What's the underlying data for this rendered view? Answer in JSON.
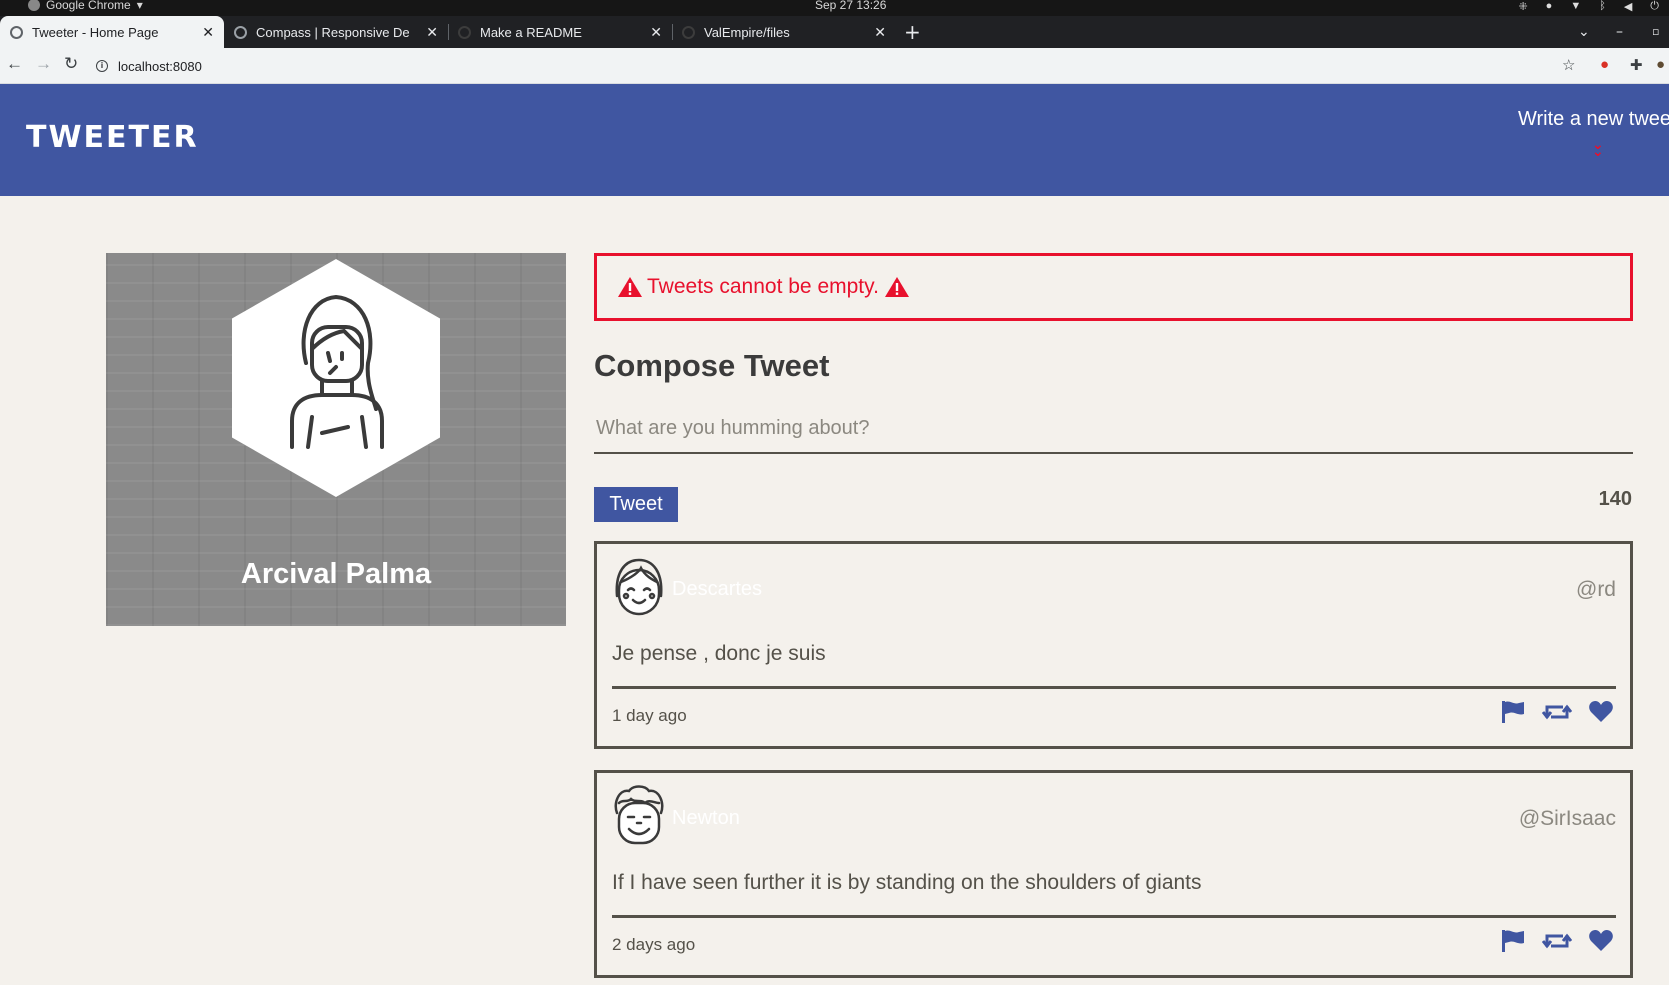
{
  "os": {
    "app_name": "Google Chrome",
    "clock": "Sep 27  13:26"
  },
  "tabs": [
    {
      "label": "Tweeter - Home Page",
      "active": true
    },
    {
      "label": "Compass | Responsive De",
      "active": false
    },
    {
      "label": "Make a README",
      "active": false
    },
    {
      "label": "ValEmpire/files",
      "active": false
    }
  ],
  "address": {
    "url": "localhost:8080"
  },
  "header": {
    "brand": "TWEETER",
    "compose_link": "Write a new tweet",
    "accent": "#4056a1",
    "alert_color": "#e8112d"
  },
  "profile": {
    "name": "Arcival Palma"
  },
  "error": {
    "message": "Tweets cannot be empty."
  },
  "compose": {
    "title": "Compose Tweet",
    "placeholder": "What are you humming about?",
    "value": "",
    "button": "Tweet",
    "counter": "140"
  },
  "tweets": [
    {
      "name": "Descartes",
      "handle": "@rd",
      "body": "Je pense , donc je suis",
      "time": "1 day ago"
    },
    {
      "name": "Newton",
      "handle": "@SirIsaac",
      "body": "If I have seen further it is by standing on the shoulders of giants",
      "time": "2 days ago"
    }
  ],
  "icons": {
    "flag": "flag-icon",
    "retweet": "retweet-icon",
    "like": "heart-icon",
    "warning": "warning-icon"
  }
}
